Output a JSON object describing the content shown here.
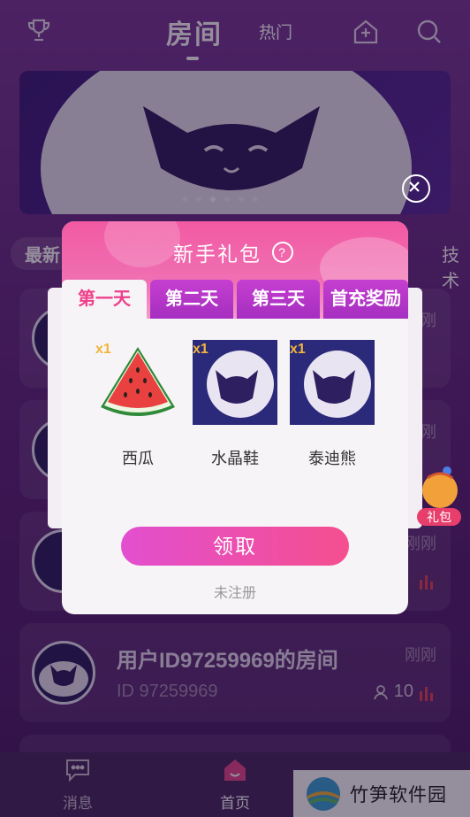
{
  "topbar": {
    "tab_main": "房间",
    "tab_hot": "热门"
  },
  "categories": {
    "first": "最新",
    "last": "技术"
  },
  "rooms": [
    {
      "title": "",
      "id": "",
      "time": "刚刚",
      "users": ""
    },
    {
      "title": "",
      "id": "",
      "time": "刚刚",
      "users": ""
    },
    {
      "title": "",
      "id": "",
      "time": "刚刚",
      "users": ""
    },
    {
      "title": "用户ID97259969的房间",
      "id": "ID 97259969",
      "time": "刚刚",
      "users": "10"
    }
  ],
  "bottom_nav": {
    "messages": "消息",
    "home": "首页"
  },
  "watermark": "竹笋软件园",
  "dialog": {
    "title": "新手礼包",
    "help_icon": "?",
    "tabs": [
      "第一天",
      "第二天",
      "第三天",
      "首充奖励"
    ],
    "gifts": [
      {
        "name": "西瓜",
        "qty": "x1",
        "icon": "watermelon-icon"
      },
      {
        "name": "水晶鞋",
        "qty": "x1",
        "icon": "cat-logo-icon"
      },
      {
        "name": "泰迪熊",
        "qty": "x1",
        "icon": "cat-logo-icon"
      }
    ],
    "claim_button": "领取",
    "unregistered": "未注册"
  },
  "float_badge": "礼包",
  "colors": {
    "accent": "#ee3f8a",
    "tab_purple": "#b536c8",
    "bg": "#6b2a87"
  }
}
